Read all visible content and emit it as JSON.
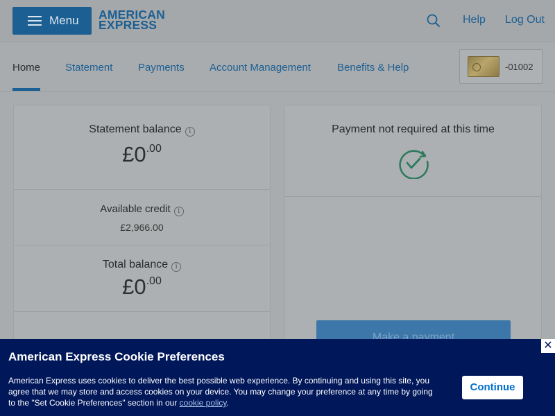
{
  "header": {
    "menu_label": "Menu",
    "logo_line1": "AMERICAN",
    "logo_line2": "EXPRESS",
    "help_label": "Help",
    "logout_label": "Log Out"
  },
  "nav": {
    "tabs": [
      {
        "label": "Home"
      },
      {
        "label": "Statement"
      },
      {
        "label": "Payments"
      },
      {
        "label": "Account Management"
      },
      {
        "label": "Benefits & Help"
      }
    ],
    "card_suffix": "-01002"
  },
  "balances": {
    "statement_label": "Statement balance",
    "statement_major": "£0",
    "statement_minor": ".00",
    "available_label": "Available credit",
    "available_value": "£2,966.00",
    "total_label": "Total balance",
    "total_major": "£0",
    "total_minor": ".00",
    "info_glyph": "i"
  },
  "payment": {
    "status": "Payment not required at this time",
    "button_label": "Make a payment"
  },
  "cookie": {
    "title": "American Express Cookie Preferences",
    "body": "American Express uses cookies to deliver the best possible web experience. By continuing and using this site, you agree that we may store and access cookies on your device. You may change your preference at any time by going to the \"Set Cookie Preferences\" section in our ",
    "link_label": "cookie policy",
    "body_end": ".",
    "continue_label": "Continue",
    "close_glyph": "✕"
  },
  "colors": {
    "brand_blue": "#1b5f93",
    "banner_navy": "#00175a",
    "check_green": "#2f7a5d"
  }
}
